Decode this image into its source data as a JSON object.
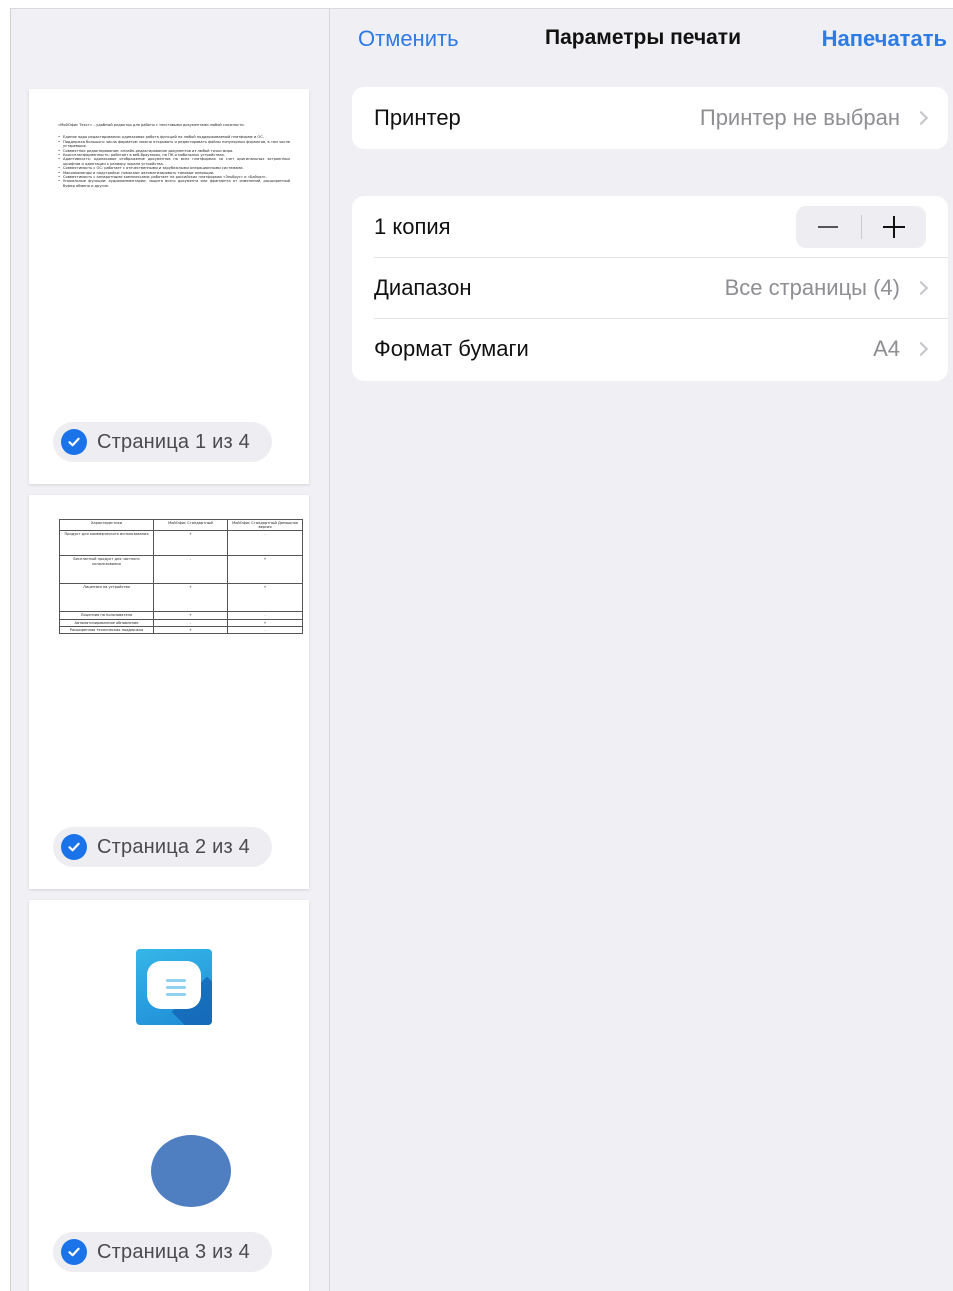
{
  "sidebar": {
    "pages": [
      {
        "label": "Страница 1 из 4",
        "intro": "«МойОфис Текст» – удобный редактор для работы с текстовыми документами любой сложности.",
        "bullets": [
          "Единое ядро редактирования: одинаковая работа функций на любой поддерживаемой платформе и ОС.",
          "Поддержка большого числа форматов: можно открывать и редактировать файлы популярных форматов, в том числе устаревших.",
          "Совместное редактирование: онлайн-редактирование документов из любой точки мира.",
          "Кроссплатформенность: работает в веб-браузерах, на ПК и мобильных устройствах.",
          "Адаптивность: одинаковое отображение документов на всех платформах за счет оригинальных встроенных шрифтов и адаптации к размеру экрана устройства.",
          "Совместимость с ОС: работает с отечественными и зарубежными операционными системами.",
          "Макрокоманды и надстройки: помогают автоматизировать типовые операции.",
          "Совместимость с аппаратными комплексами: работает на российских платформах «Эльбрус» и «Байкал».",
          "Уникальные функции: аудиокомментарии, защита всего документа или фрагмента от изменений, расширенный буфер обмена и другие."
        ]
      },
      {
        "label": "Страница 2 из 4",
        "table": {
          "headers": [
            "Характеристики",
            "МойОфис Стандартный",
            "МойОфис Стандартный Домашняя версия"
          ],
          "rows": [
            [
              "Продукт для коммерческого использования",
              "+",
              "-"
            ],
            [
              "Бесплатный продукт для частного использования",
              "-",
              "+"
            ],
            [
              "Лицензия на устройство",
              "+",
              "+"
            ],
            [
              "Лицензия на пользователя",
              "+",
              "-"
            ],
            [
              "Автоматизированное обновление",
              "-",
              "+"
            ],
            [
              "Расширенная техническая поддержка",
              "+",
              "-"
            ]
          ]
        }
      },
      {
        "label": "Страница 3 из 4",
        "icons": [
          "myoffice-text-app-icon",
          "blue-ellipse-shape"
        ]
      }
    ]
  },
  "navbar": {
    "cancel": "Отменить",
    "title": "Параметры печати",
    "print": "Напечатать"
  },
  "printer": {
    "label": "Принтер",
    "value": "Принтер не выбран"
  },
  "copies": {
    "label": "1 копия",
    "minus": "−",
    "plus": "+"
  },
  "range": {
    "label": "Диапазон",
    "value": "Все страницы (4)"
  },
  "paper": {
    "label": "Формат бумаги",
    "value": "A4"
  },
  "colors": {
    "accent": "#2d7be5",
    "check": "#1a73e8",
    "background": "#efeff4",
    "secondary_text": "#8e8e93"
  }
}
